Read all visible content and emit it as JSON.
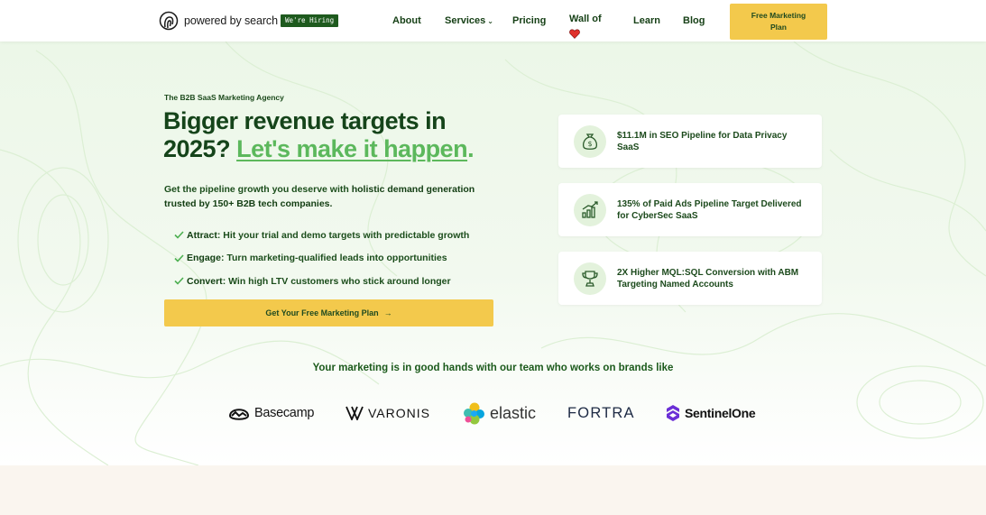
{
  "header": {
    "logo_text": "powered by search",
    "hiring_badge": "We're Hiring",
    "nav": {
      "about": "About",
      "services": "Services",
      "pricing": "Pricing",
      "wall_of": "Wall of",
      "learn": "Learn",
      "blog": "Blog"
    },
    "cta_line1": "Free Marketing",
    "cta_line2": "Plan"
  },
  "hero": {
    "eyebrow": "The B2B SaaS Marketing Agency",
    "headline_line1": "Bigger revenue targets in",
    "headline_year": "2025?",
    "headline_accent": "Let's make it happen",
    "headline_period": ".",
    "sub_part1": "Get the pipeline growth you deserve with ",
    "sub_bold": "holistic demand generation",
    "sub_part2": "trusted by 150+ B2B tech companies.",
    "bullets": [
      {
        "term": "Attract",
        "text": ": Hit your trial and demo targets with predictable growth"
      },
      {
        "term": "Engage",
        "text": ": Turn marketing-qualified leads into opportunities"
      },
      {
        "term": "Convert",
        "text": ": Win high LTV customers who stick around longer"
      }
    ],
    "cta_label": "Get Your Free Marketing Plan",
    "cta_arrow": "→"
  },
  "stats": [
    {
      "text": "$11.1M in SEO Pipeline for Data Privacy SaaS",
      "icon": "money-bag-icon"
    },
    {
      "text": "135% of Paid Ads Pipeline Target Delivered for CyberSec SaaS",
      "icon": "growth-chart-icon"
    },
    {
      "text": "2X Higher MQL:SQL Conversion with ABM Targeting Named Accounts",
      "icon": "trophy-icon"
    }
  ],
  "trust": {
    "heading": "Your marketing is in good hands with our team who works on brands like",
    "brands": [
      "Basecamp",
      "VARONIS",
      "elastic",
      "FORTRA",
      "SentinelOne"
    ]
  },
  "colors": {
    "brand_green": "#15441a",
    "accent_green": "#5cb85c",
    "cta_yellow": "#f3c94c",
    "heart_red": "#e0312b"
  }
}
